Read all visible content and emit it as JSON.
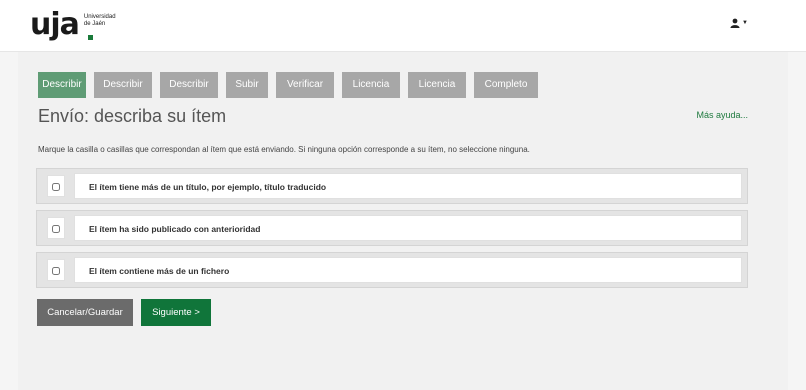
{
  "header": {
    "logo_mark": "uja",
    "logo_line1": "Universidad",
    "logo_line2": "de Jaén",
    "user_icon": "user-icon",
    "accent_color": "#10753a"
  },
  "steps": [
    {
      "label": "Describir",
      "state": "active"
    },
    {
      "label": "Describir",
      "state": "inactive"
    },
    {
      "label": "Describir",
      "state": "inactive"
    },
    {
      "label": "Subir",
      "state": "inactive"
    },
    {
      "label": "Verificar",
      "state": "inactive"
    },
    {
      "label": "Licencia",
      "state": "inactive"
    },
    {
      "label": "Licencia",
      "state": "inactive"
    },
    {
      "label": "Completo",
      "state": "inactive"
    }
  ],
  "page": {
    "title": "Envío: describa su ítem",
    "help_link": "Más ayuda...",
    "instructions": "Marque la casilla o casillas que correspondan al ítem que está enviando. Si ninguna opción corresponde a su ítem, no seleccione ninguna."
  },
  "options": [
    {
      "label": "El ítem tiene más de un título, por ejemplo, título traducido",
      "checked": false
    },
    {
      "label": "El ítem ha sido publicado con anterioridad",
      "checked": false
    },
    {
      "label": "El ítem contiene más de un fichero",
      "checked": false
    }
  ],
  "buttons": {
    "cancel": "Cancelar/Guardar",
    "next": "Siguiente >"
  }
}
